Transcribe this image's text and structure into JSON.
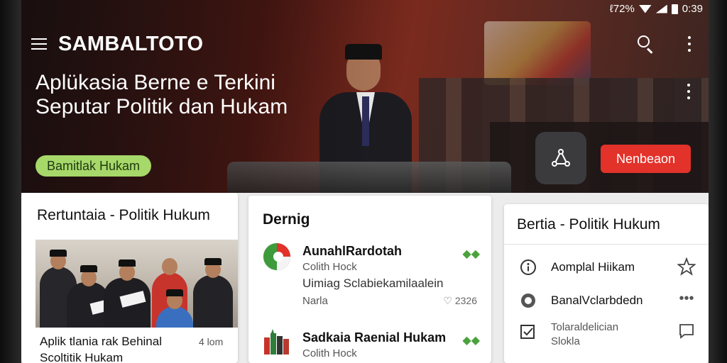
{
  "status_bar": {
    "left_text": "ℓ72%",
    "time": "0:39"
  },
  "app": {
    "title": "SAMBALTOTO"
  },
  "hero": {
    "title_line1": "Aplükasia Berne e Terkini",
    "title_line2": "Seputar Politik dan Hukam",
    "chip": "Bamitlak Hukam",
    "action_button": "Nenbeaon"
  },
  "card_left": {
    "heading": "Rertuntaia - Politik Hukum",
    "caption_line1": "Aplik tlania rak Behinal",
    "caption_line2": "Scoltitik Hukam",
    "meta": "4 lom"
  },
  "card_middle": {
    "heading": "Dernig",
    "items": [
      {
        "title": "AunahlRardotah",
        "subtitle": "Colith Hock",
        "desc": "Uimiag Sclabiekamilaalein",
        "source": "Narla",
        "count": "2326"
      },
      {
        "title": "Sadkaia Raenial Hukam",
        "subtitle": "Colith Hock"
      }
    ]
  },
  "card_right": {
    "heading": "Bertia - Politik Hukum",
    "rows": [
      {
        "label": "Aomplal Hiikam"
      },
      {
        "label": "BanalVclarbdedn"
      },
      {
        "label_line1": "Tolaraldelician",
        "label_line2": "Slokla"
      }
    ]
  },
  "colors": {
    "accent_red": "#e2322a",
    "chip_green": "#a7d86a",
    "trend_green": "#49a33b"
  }
}
